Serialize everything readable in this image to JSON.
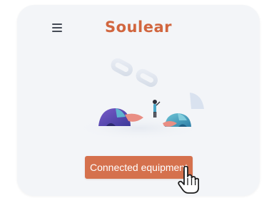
{
  "header": {
    "menu_icon": "hamburger-menu-icon",
    "brand": "Soulear"
  },
  "main": {
    "illustration_icon": "disconnected-link-icon",
    "connect_button_label": "Connected equipment"
  },
  "cursor_icon": "hand-pointer-icon",
  "colors": {
    "brand": "#d1663f",
    "button": "#d5714d",
    "card_background": "#f3f5f8"
  }
}
